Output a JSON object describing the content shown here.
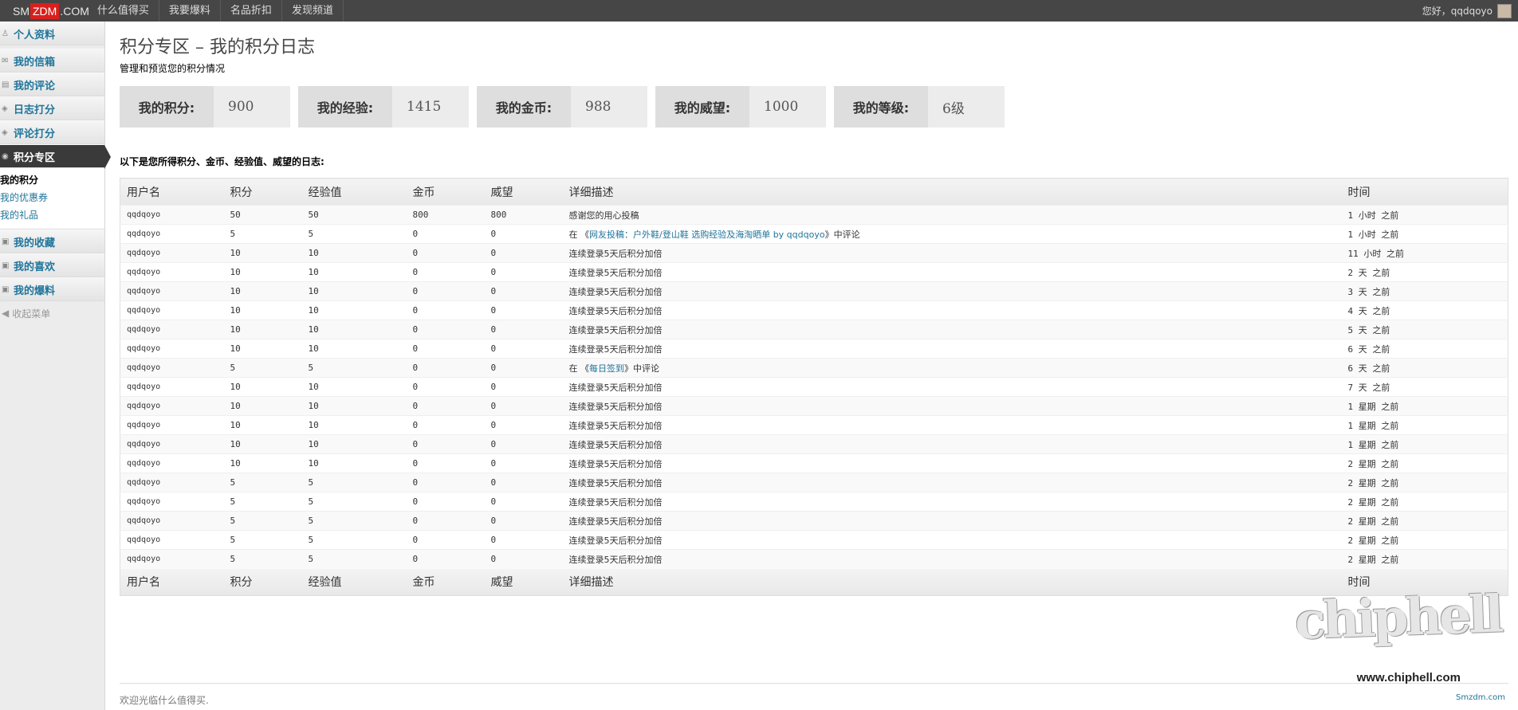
{
  "topbar": {
    "logo": {
      "part1": "SM",
      "part2": "ZDM",
      "part3": ".COM"
    },
    "nav": [
      "什么值得买",
      "我要爆料",
      "名品折扣",
      "发现频道"
    ],
    "greeting": "您好，qqdqoyo"
  },
  "sidebar": {
    "items": [
      {
        "label": "个人资料",
        "icon": "user-icon"
      },
      {
        "label": "我的信箱",
        "icon": "mail-icon"
      },
      {
        "label": "我的评论",
        "icon": "comment-icon"
      },
      {
        "label": "日志打分",
        "icon": "rating-icon"
      },
      {
        "label": "评论打分",
        "icon": "rating-icon"
      },
      {
        "label": "积分专区",
        "icon": "coin-icon",
        "active": true
      },
      {
        "label": "我的收藏",
        "icon": "bookmark-icon"
      },
      {
        "label": "我的喜欢",
        "icon": "heart-icon"
      },
      {
        "label": "我的爆料",
        "icon": "post-icon"
      }
    ],
    "submenu": [
      "我的积分",
      "我的优惠券",
      "我的礼品"
    ],
    "collapse": "收起菜单"
  },
  "page": {
    "title": "积分专区 – 我的积分日志",
    "subtitle": "管理和预览您的积分情况"
  },
  "stats": [
    {
      "label": "我的积分:",
      "value": "900"
    },
    {
      "label": "我的经验:",
      "value": "1415"
    },
    {
      "label": "我的金币:",
      "value": "988"
    },
    {
      "label": "我的威望:",
      "value": "1000"
    },
    {
      "label": "我的等级:",
      "value": "6级"
    }
  ],
  "intro": "以下是您所得积分、金币、经验值、威望的日志:",
  "table": {
    "headers": [
      "用户名",
      "积分",
      "经验值",
      "金币",
      "威望",
      "详细描述",
      "时间"
    ],
    "rows": [
      {
        "user": "qqdqoyo",
        "points": "50",
        "exp": "50",
        "gold": "800",
        "prestige": "800",
        "desc": "感谢您的用心投稿",
        "link": "",
        "suffix": "",
        "time": "1 小时 之前"
      },
      {
        "user": "qqdqoyo",
        "points": "5",
        "exp": "5",
        "gold": "0",
        "prestige": "0",
        "desc": "在 《",
        "link": "网友投稿：户外鞋/登山鞋 选购经验及海淘晒单  by qqdqoyo",
        "suffix": "》中评论",
        "time": "1 小时 之前"
      },
      {
        "user": "qqdqoyo",
        "points": "10",
        "exp": "10",
        "gold": "0",
        "prestige": "0",
        "desc": "连续登录5天后积分加倍",
        "link": "",
        "suffix": "",
        "time": "11 小时 之前"
      },
      {
        "user": "qqdqoyo",
        "points": "10",
        "exp": "10",
        "gold": "0",
        "prestige": "0",
        "desc": "连续登录5天后积分加倍",
        "link": "",
        "suffix": "",
        "time": "2 天 之前"
      },
      {
        "user": "qqdqoyo",
        "points": "10",
        "exp": "10",
        "gold": "0",
        "prestige": "0",
        "desc": "连续登录5天后积分加倍",
        "link": "",
        "suffix": "",
        "time": "3 天 之前"
      },
      {
        "user": "qqdqoyo",
        "points": "10",
        "exp": "10",
        "gold": "0",
        "prestige": "0",
        "desc": "连续登录5天后积分加倍",
        "link": "",
        "suffix": "",
        "time": "4 天 之前"
      },
      {
        "user": "qqdqoyo",
        "points": "10",
        "exp": "10",
        "gold": "0",
        "prestige": "0",
        "desc": "连续登录5天后积分加倍",
        "link": "",
        "suffix": "",
        "time": "5 天 之前"
      },
      {
        "user": "qqdqoyo",
        "points": "10",
        "exp": "10",
        "gold": "0",
        "prestige": "0",
        "desc": "连续登录5天后积分加倍",
        "link": "",
        "suffix": "",
        "time": "6 天 之前"
      },
      {
        "user": "qqdqoyo",
        "points": "5",
        "exp": "5",
        "gold": "0",
        "prestige": "0",
        "desc": "在 《",
        "link": "每日签到",
        "suffix": "》中评论",
        "time": "6 天 之前"
      },
      {
        "user": "qqdqoyo",
        "points": "10",
        "exp": "10",
        "gold": "0",
        "prestige": "0",
        "desc": "连续登录5天后积分加倍",
        "link": "",
        "suffix": "",
        "time": "7 天 之前"
      },
      {
        "user": "qqdqoyo",
        "points": "10",
        "exp": "10",
        "gold": "0",
        "prestige": "0",
        "desc": "连续登录5天后积分加倍",
        "link": "",
        "suffix": "",
        "time": "1 星期 之前"
      },
      {
        "user": "qqdqoyo",
        "points": "10",
        "exp": "10",
        "gold": "0",
        "prestige": "0",
        "desc": "连续登录5天后积分加倍",
        "link": "",
        "suffix": "",
        "time": "1 星期 之前"
      },
      {
        "user": "qqdqoyo",
        "points": "10",
        "exp": "10",
        "gold": "0",
        "prestige": "0",
        "desc": "连续登录5天后积分加倍",
        "link": "",
        "suffix": "",
        "time": "1 星期 之前"
      },
      {
        "user": "qqdqoyo",
        "points": "10",
        "exp": "10",
        "gold": "0",
        "prestige": "0",
        "desc": "连续登录5天后积分加倍",
        "link": "",
        "suffix": "",
        "time": "2 星期 之前"
      },
      {
        "user": "qqdqoyo",
        "points": "5",
        "exp": "5",
        "gold": "0",
        "prestige": "0",
        "desc": "连续登录5天后积分加倍",
        "link": "",
        "suffix": "",
        "time": "2 星期 之前"
      },
      {
        "user": "qqdqoyo",
        "points": "5",
        "exp": "5",
        "gold": "0",
        "prestige": "0",
        "desc": "连续登录5天后积分加倍",
        "link": "",
        "suffix": "",
        "time": "2 星期 之前"
      },
      {
        "user": "qqdqoyo",
        "points": "5",
        "exp": "5",
        "gold": "0",
        "prestige": "0",
        "desc": "连续登录5天后积分加倍",
        "link": "",
        "suffix": "",
        "time": "2 星期 之前"
      },
      {
        "user": "qqdqoyo",
        "points": "5",
        "exp": "5",
        "gold": "0",
        "prestige": "0",
        "desc": "连续登录5天后积分加倍",
        "link": "",
        "suffix": "",
        "time": "2 星期 之前"
      },
      {
        "user": "qqdqoyo",
        "points": "5",
        "exp": "5",
        "gold": "0",
        "prestige": "0",
        "desc": "连续登录5天后积分加倍",
        "link": "",
        "suffix": "",
        "time": "2 星期 之前"
      }
    ]
  },
  "footer": "欢迎光临什么值得买.",
  "watermark": {
    "big": "chiphell",
    "url": "www.chiphell.com",
    "small": "Smzdm.com"
  },
  "colors": {
    "topbar": "#464646",
    "link": "#21759b",
    "logo_red": "#d9201d",
    "active_nav": "#3a3a3a"
  }
}
